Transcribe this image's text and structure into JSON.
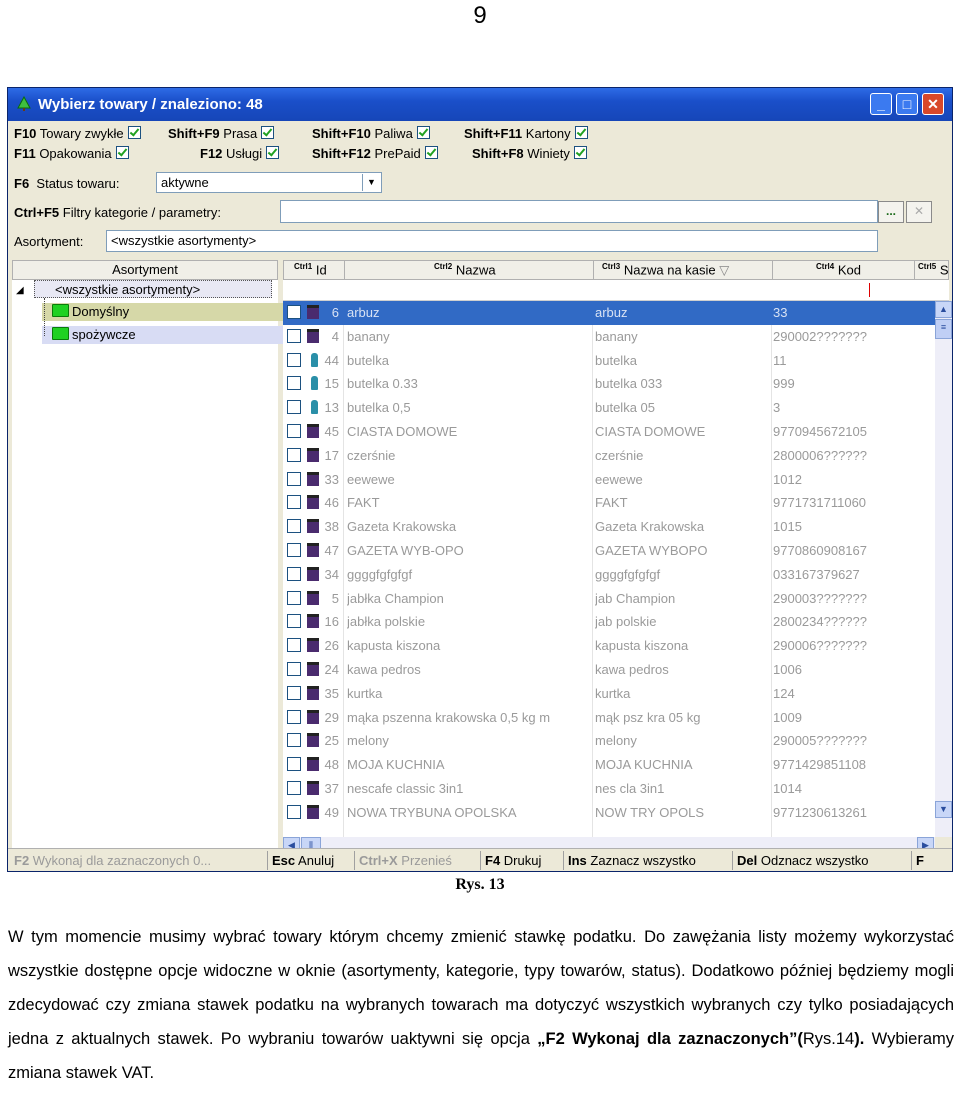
{
  "page_number": "9",
  "window": {
    "title": "Wybierz towary / znaleziono: 48",
    "options": [
      {
        "key": "F10",
        "label": "Towary zwykłe"
      },
      {
        "key": "Shift+F9",
        "label": "Prasa"
      },
      {
        "key": "Shift+F10",
        "label": "Paliwa"
      },
      {
        "key": "Shift+F11",
        "label": "Kartony"
      },
      {
        "key": "F11",
        "label": "Opakowania"
      },
      {
        "key": "F12",
        "label": "Usługi"
      },
      {
        "key": "Shift+F12",
        "label": "PrePaid"
      },
      {
        "key": "Shift+F8",
        "label": "Winiety"
      }
    ],
    "status": {
      "key": "F6",
      "label": "Status towaru:",
      "value": "aktywne"
    },
    "filter": {
      "key": "Ctrl+F5",
      "label": "Filtry kategorie / parametry:",
      "value": "",
      "btn_more": "...",
      "btn_clear": "✕"
    },
    "assortment": {
      "label": "Asortyment:",
      "value": "<wszystkie asortymenty>"
    },
    "tree": {
      "header": "Asortyment",
      "root": "<wszystkie asortymenty>",
      "children": [
        "Domyślny",
        "spożywcze"
      ]
    },
    "grid": {
      "columns": [
        {
          "ctrl": "Ctrl",
          "num": "1",
          "label": "Id"
        },
        {
          "ctrl": "Ctrl",
          "num": "2",
          "label": "Nazwa"
        },
        {
          "ctrl": "Ctrl",
          "num": "3",
          "label": "Nazwa na kasie"
        },
        {
          "ctrl": "Ctrl",
          "num": "4",
          "label": "Kod"
        },
        {
          "ctrl": "Ctrl",
          "num": "5",
          "label": "S"
        }
      ],
      "rows": [
        {
          "icon": "calendar-icon",
          "id": "6",
          "nazwa": "arbuz",
          "kasa": "arbuz",
          "kod": "33",
          "selected": true
        },
        {
          "icon": "calendar-icon",
          "id": "4",
          "nazwa": "banany",
          "kasa": "banany",
          "kod": "290002???????"
        },
        {
          "icon": "bottle-icon",
          "id": "44",
          "nazwa": "butelka",
          "kasa": "butelka",
          "kod": "11"
        },
        {
          "icon": "bottle-icon",
          "id": "15",
          "nazwa": "butelka 0.33",
          "kasa": "butelka 033",
          "kod": "999"
        },
        {
          "icon": "bottle-icon",
          "id": "13",
          "nazwa": "butelka 0,5",
          "kasa": "butelka 05",
          "kod": "3"
        },
        {
          "icon": "calendar-icon",
          "id": "45",
          "nazwa": "CIASTA DOMOWE",
          "kasa": "CIASTA DOMOWE",
          "kod": "9770945672105"
        },
        {
          "icon": "calendar-icon",
          "id": "17",
          "nazwa": "czerśnie",
          "kasa": "czerśnie",
          "kod": "2800006??????"
        },
        {
          "icon": "calendar-icon",
          "id": "33",
          "nazwa": "eewewe",
          "kasa": "eewewe",
          "kod": "1012"
        },
        {
          "icon": "calendar-icon",
          "id": "46",
          "nazwa": "FAKT",
          "kasa": "FAKT",
          "kod": "9771731711060"
        },
        {
          "icon": "calendar-icon",
          "id": "38",
          "nazwa": "Gazeta Krakowska",
          "kasa": "Gazeta Krakowska",
          "kod": "1015"
        },
        {
          "icon": "calendar-icon",
          "id": "47",
          "nazwa": "GAZETA WYB-OPO",
          "kasa": "GAZETA WYBOPO",
          "kod": "9770860908167"
        },
        {
          "icon": "calendar-icon",
          "id": "34",
          "nazwa": "ggggfgfgfgf",
          "kasa": "ggggfgfgfgf",
          "kod": "033167379627"
        },
        {
          "icon": "calendar-icon",
          "id": "5",
          "nazwa": "jabłka Champion",
          "kasa": "jab Champion",
          "kod": "290003???????"
        },
        {
          "icon": "calendar-icon",
          "id": "16",
          "nazwa": "jabłka polskie",
          "kasa": "jab polskie",
          "kod": "2800234??????"
        },
        {
          "icon": "calendar-icon",
          "id": "26",
          "nazwa": "kapusta kiszona",
          "kasa": "kapusta kiszona",
          "kod": "290006???????"
        },
        {
          "icon": "calendar-icon",
          "id": "24",
          "nazwa": "kawa pedros",
          "kasa": "kawa pedros",
          "kod": "1006"
        },
        {
          "icon": "calendar-icon",
          "id": "35",
          "nazwa": "kurtka",
          "kasa": "kurtka",
          "kod": "124"
        },
        {
          "icon": "calendar-icon",
          "id": "29",
          "nazwa": "mąka pszenna krakowska 0,5 kg m",
          "kasa": "mąk psz kra 05 kg",
          "kod": "1009"
        },
        {
          "icon": "calendar-icon",
          "id": "25",
          "nazwa": "melony",
          "kasa": "melony",
          "kod": "290005???????"
        },
        {
          "icon": "calendar-icon",
          "id": "48",
          "nazwa": "MOJA KUCHNIA",
          "kasa": "MOJA KUCHNIA",
          "kod": "9771429851108"
        },
        {
          "icon": "calendar-icon",
          "id": "37",
          "nazwa": "nescafe classic 3in1",
          "kasa": "nes cla 3in1",
          "kod": "1014"
        },
        {
          "icon": "calendar-icon",
          "id": "49",
          "nazwa": "NOWA TRYBUNA OPOLSKA",
          "kasa": "NOW TRY OPOLS",
          "kod": "9771230613261"
        }
      ]
    },
    "bottom_bar": [
      {
        "key": "F2",
        "label": "Wykonaj dla zaznaczonych 0...",
        "disabled": true
      },
      {
        "key": "Esc",
        "label": "Anuluj",
        "disabled": false
      },
      {
        "key": "Ctrl+X",
        "label": "Przenieś",
        "disabled": true
      },
      {
        "key": "F4",
        "label": "Drukuj",
        "disabled": false
      },
      {
        "key": "Ins",
        "label": "Zaznacz wszystko",
        "disabled": false
      },
      {
        "key": "Del",
        "label": "Odznacz wszystko",
        "disabled": false
      },
      {
        "key": "F",
        "label": "",
        "disabled": false
      }
    ]
  },
  "caption": "Rys. 13",
  "paragraph": {
    "p1": "W tym momencie musimy wybrać towary którym chcemy zmienić stawkę podatku. Do zawężania listy możemy wykorzystać wszystkie dostępne opcje widoczne w oknie (asortymenty, kategorie, typy towarów, status). Dodatkowo później będziemy mogli zdecydować czy zmiana stawek podatku na wybranych towarach ma dotyczyć wszystkich wybranych czy tylko posiadających jedna z aktualnych stawek. Po wybraniu towarów uaktywni się opcja ",
    "bold": "„F2 Wykonaj dla zaznaczonych”(",
    "p2": "Rys.14",
    "bold2": ").",
    "p3": " Wybieramy zmiana stawek VAT."
  },
  "colors": {
    "title_bar": "#1a4fc9",
    "selection": "#316ac5",
    "folder": "#1fd123",
    "close_btn": "#d8482a"
  }
}
